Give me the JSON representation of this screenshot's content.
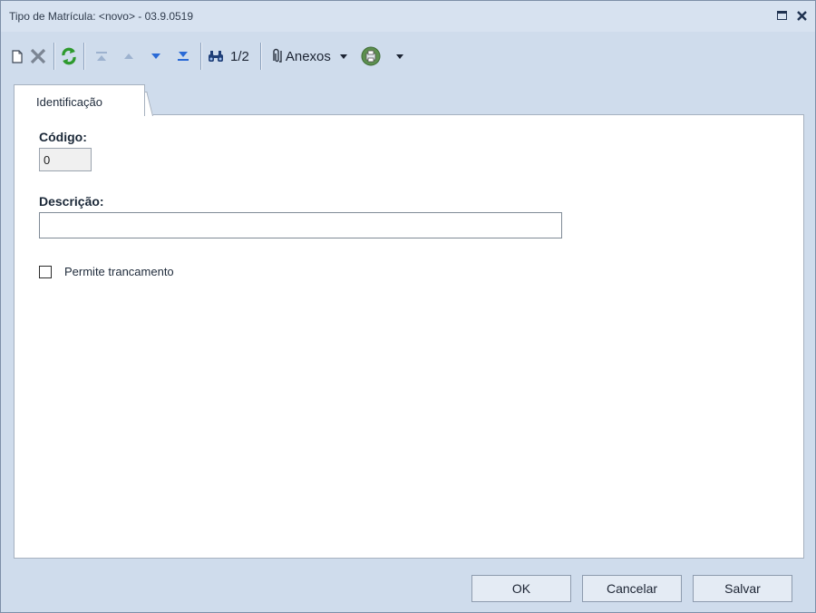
{
  "window": {
    "title": "Tipo de Matrícula: <novo> - 03.9.0519"
  },
  "toolbar": {
    "record_position": "1/2",
    "attachments_label": "Anexos"
  },
  "tabs": [
    {
      "label": "Identificação",
      "active": true
    }
  ],
  "form": {
    "codigo_label": "Código:",
    "codigo_value": "0",
    "descricao_label": "Descrição:",
    "descricao_value": "",
    "permite_trancamento_label": "Permite trancamento",
    "permite_trancamento_checked": false
  },
  "footer": {
    "ok_label": "OK",
    "cancel_label": "Cancelar",
    "save_label": "Salvar"
  },
  "colors": {
    "frame": "#cfdcec",
    "titlebar": "#d7e2f0",
    "refresh_green": "#2e9a2e",
    "nav_blue": "#2a6ad6"
  }
}
